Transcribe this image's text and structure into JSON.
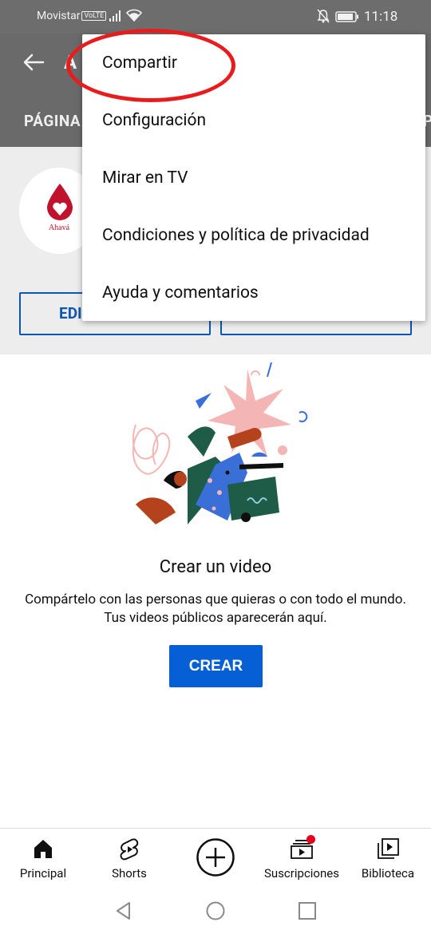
{
  "status_bar": {
    "carrier": "Movistar",
    "network_badge": "VoLTE",
    "time": "11:18",
    "icons": [
      "signal-icon",
      "wifi-icon",
      "notifications-off-icon",
      "battery-icon"
    ]
  },
  "app_bar": {
    "title_partial": "A",
    "tab_visible": "PÁGINA",
    "tab_right_partial": "P"
  },
  "channel": {
    "avatar_text": "Ahavá",
    "edit_button_partial": "EDI"
  },
  "menu": {
    "items": [
      {
        "label": "Compartir"
      },
      {
        "label": "Configuración"
      },
      {
        "label": "Mirar en TV"
      },
      {
        "label": "Condiciones y política de privacidad"
      },
      {
        "label": "Ayuda y comentarios"
      }
    ],
    "highlight_color": "#e81c1c"
  },
  "empty_state": {
    "title": "Crear un video",
    "description_line1": "Compártelo con las personas que quieras o con todo el mundo.",
    "description_line2": "Tus videos públicos aparecerán aquí.",
    "button": "CREAR"
  },
  "bottom_nav": {
    "items": [
      {
        "label": "Principal",
        "icon": "home-icon"
      },
      {
        "label": "Shorts",
        "icon": "shorts-icon"
      },
      {
        "label": "",
        "icon": "add-icon"
      },
      {
        "label": "Suscripciones",
        "icon": "subscriptions-icon"
      },
      {
        "label": "Biblioteca",
        "icon": "library-icon"
      }
    ]
  },
  "colors": {
    "accent_blue": "#065fd4",
    "notification_red": "#e4011b",
    "scrim": "#6a6a6a"
  }
}
